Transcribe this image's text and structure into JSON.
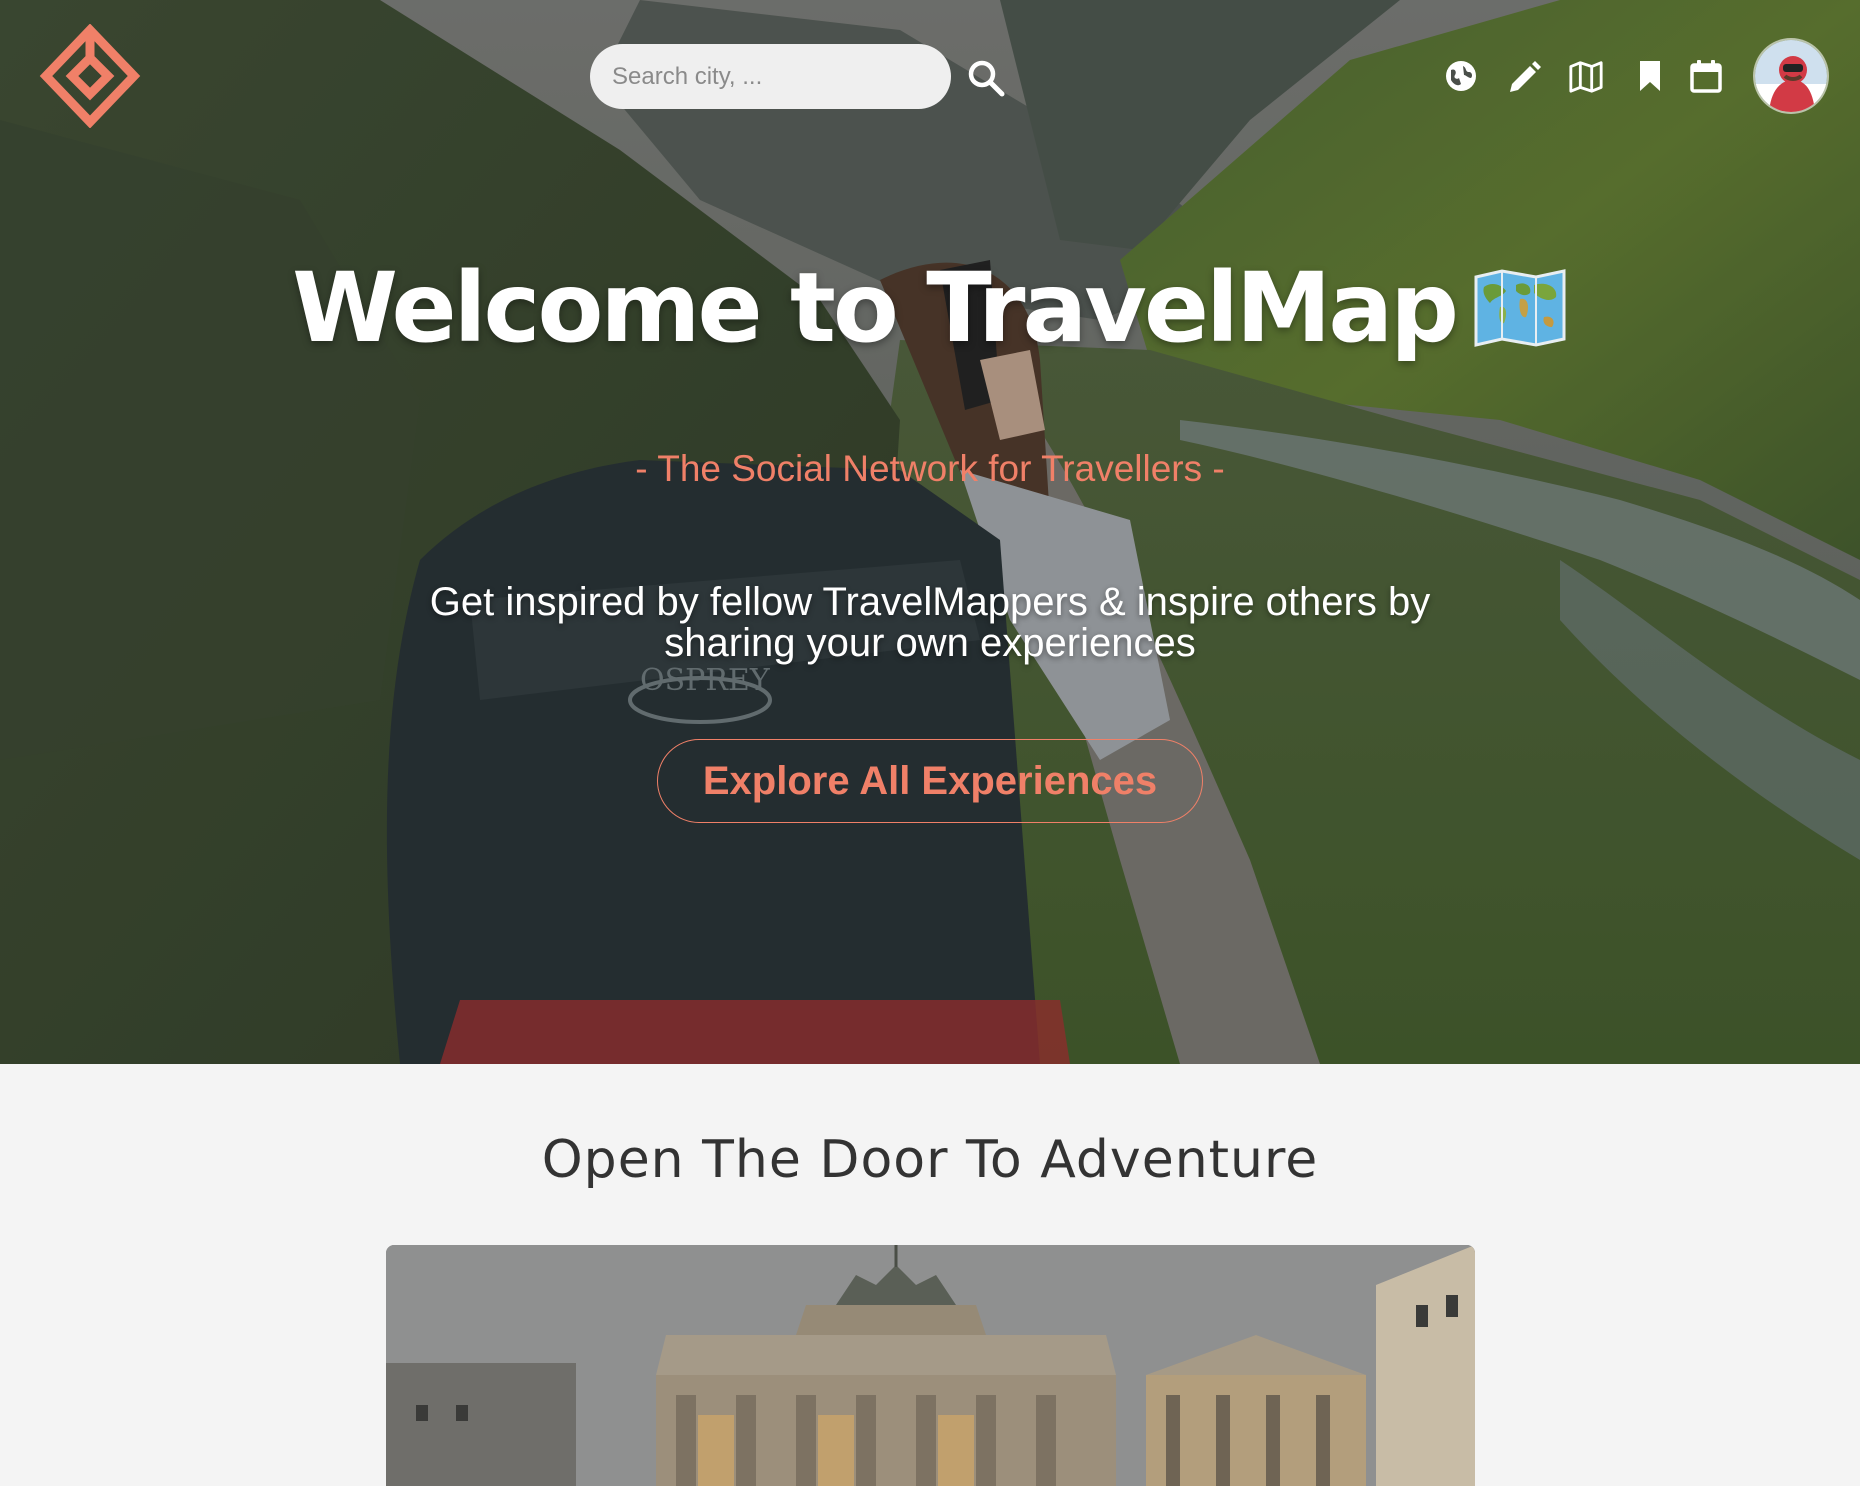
{
  "nav": {
    "search": {
      "placeholder": "Search city, ..."
    },
    "icons": [
      "globe-icon",
      "pencil-icon",
      "map-icon",
      "bookmark-icon",
      "calendar-icon"
    ]
  },
  "hero": {
    "title": "Welcome to TravelMap",
    "subtitle": "- The Social Network for Travellers -",
    "description": "Get inspired by fellow TravelMappers & inspire others by sharing your own experiences",
    "cta_label": "Explore All Experiences"
  },
  "section": {
    "title": "Open The Door To Adventure"
  },
  "colors": {
    "accent": "#f08068",
    "text_dark": "#333333",
    "page_bg": "#f4f4f4"
  }
}
